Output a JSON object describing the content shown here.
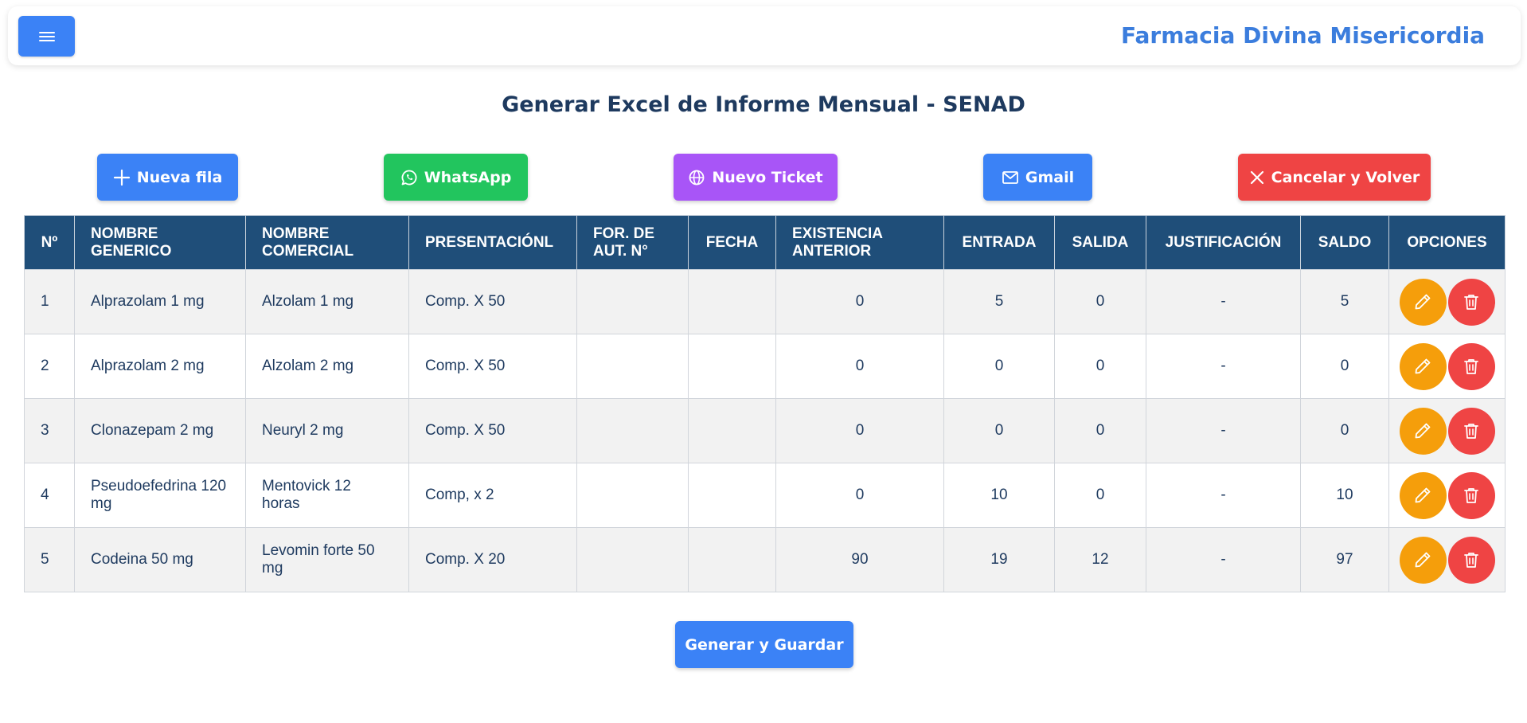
{
  "header": {
    "brand": "Farmacia Divina Misericordia",
    "menu_icon": "hamburger-menu-icon"
  },
  "page": {
    "title": "Generar Excel de Informe Mensual - SENAD"
  },
  "actions": {
    "new_row": "Nueva fila",
    "whatsapp": "WhatsApp",
    "new_ticket": "Nuevo Ticket",
    "gmail": "Gmail",
    "cancel": "Cancelar y Volver"
  },
  "colors": {
    "primary": "#3b82f6",
    "whatsapp": "#22c55e",
    "ticket": "#a855f7",
    "danger": "#ef4444",
    "edit": "#f59e0b",
    "table_header": "#1f4e79"
  },
  "table": {
    "headers": {
      "num": "Nº",
      "generic": "NOMBRE GENERICO",
      "commercial": "NOMBRE COMERCIAL",
      "presentation": "PRESENTACIÓNL",
      "auth": "FOR. DE AUT. N°",
      "date": "FECHA",
      "prev_stock": "EXISTENCIA ANTERIOR",
      "entry": "ENTRADA",
      "exit": "SALIDA",
      "justification": "JUSTIFICACIÓN",
      "balance": "SALDO",
      "options": "OPCIONES"
    },
    "rows": [
      {
        "num": "1",
        "generic": "Alprazolam 1 mg",
        "commercial": "Alzolam 1 mg",
        "presentation": "Comp. X 50",
        "auth": "",
        "date": "",
        "prev_stock": "0",
        "entry": "5",
        "exit": "0",
        "justification": "-",
        "balance": "5"
      },
      {
        "num": "2",
        "generic": "Alprazolam 2 mg",
        "commercial": "Alzolam 2 mg",
        "presentation": "Comp. X 50",
        "auth": "",
        "date": "",
        "prev_stock": "0",
        "entry": "0",
        "exit": "0",
        "justification": "-",
        "balance": "0"
      },
      {
        "num": "3",
        "generic": "Clonazepam 2 mg",
        "commercial": "Neuryl 2 mg",
        "presentation": "Comp. X 50",
        "auth": "",
        "date": "",
        "prev_stock": "0",
        "entry": "0",
        "exit": "0",
        "justification": "-",
        "balance": "0"
      },
      {
        "num": "4",
        "generic": "Pseudoefedrina 120 mg",
        "commercial": "Mentovick 12 horas",
        "presentation": "Comp, x 2",
        "auth": "",
        "date": "",
        "prev_stock": "0",
        "entry": "10",
        "exit": "0",
        "justification": "-",
        "balance": "10"
      },
      {
        "num": "5",
        "generic": "Codeina 50 mg",
        "commercial": "Levomin forte 50 mg",
        "presentation": "Comp. X 20",
        "auth": "",
        "date": "",
        "prev_stock": "90",
        "entry": "19",
        "exit": "12",
        "justification": "-",
        "balance": "97"
      }
    ]
  },
  "footer": {
    "save": "Generar y Guardar"
  }
}
